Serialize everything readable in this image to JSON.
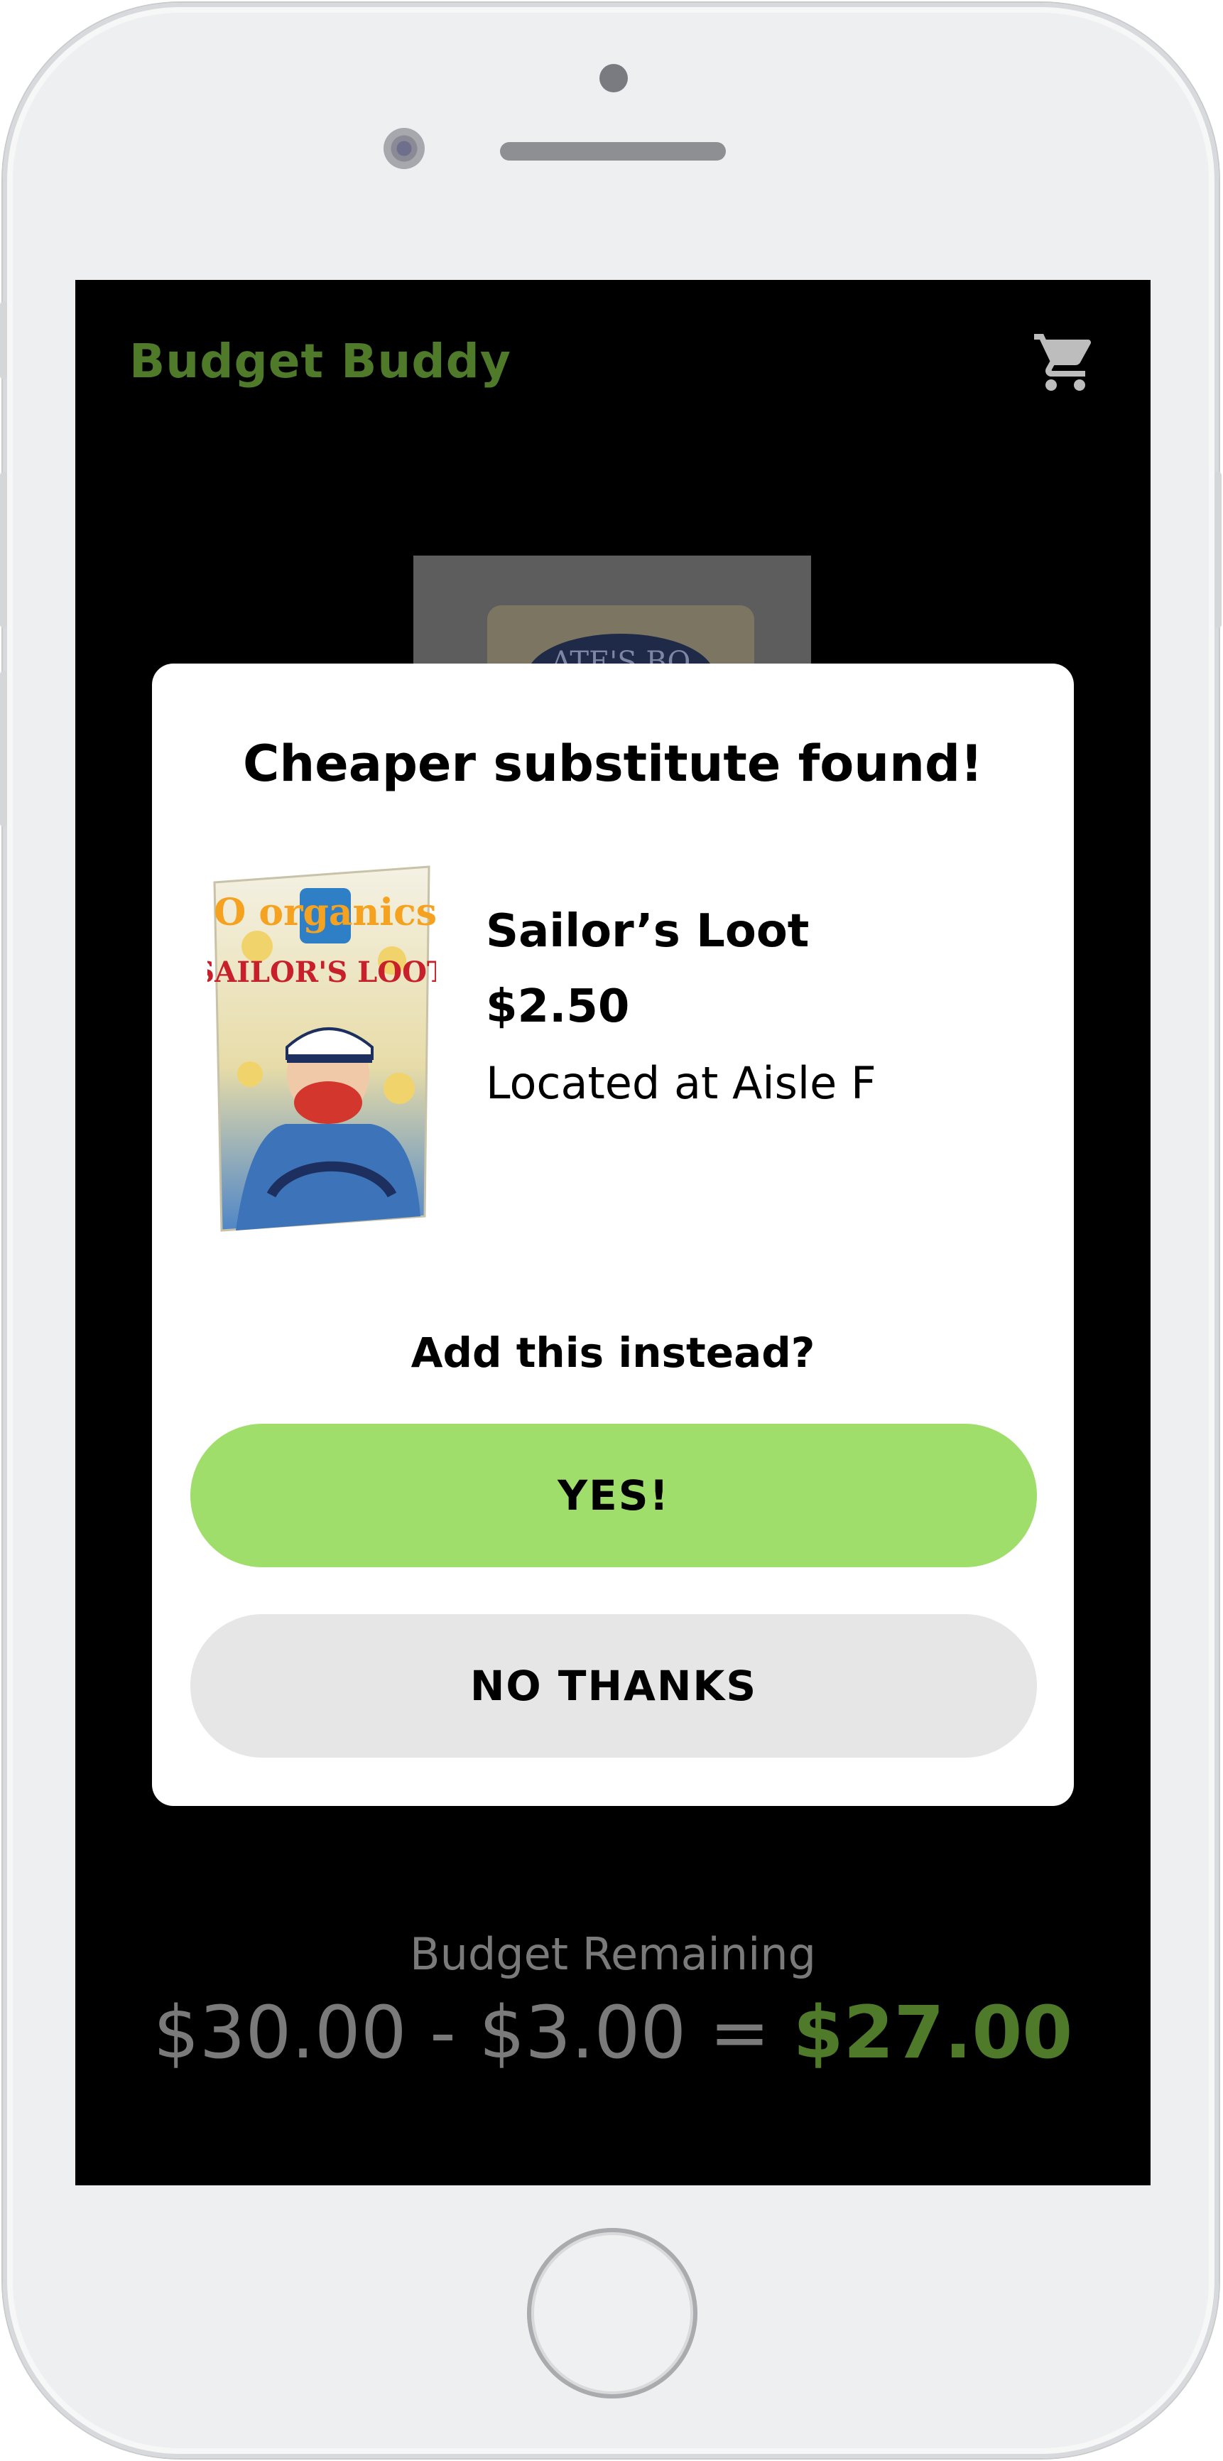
{
  "app": {
    "title": "Budget Buddy",
    "cart_icon": "shopping-cart-icon",
    "accent_color": "#4f7a2a"
  },
  "background_product": {
    "label_text": "ATE'S BO"
  },
  "modal": {
    "title": "Cheaper substitute found!",
    "product": {
      "name": "Sailor’s Loot",
      "price": "$2.50",
      "location": "Located at Aisle F",
      "bag_brand": "O organics",
      "bag_name": "SAILOR'S LOOT"
    },
    "question": "Add this instead?",
    "yes_label": "YES!",
    "no_label": "NO THANKS",
    "yes_color": "#a0de6c",
    "no_color": "#e6e6e6"
  },
  "budget": {
    "label": "Budget Remaining",
    "start": "$30.00",
    "minus": "-",
    "spent": "$3.00",
    "equals": "=",
    "remaining": "$27.00"
  }
}
